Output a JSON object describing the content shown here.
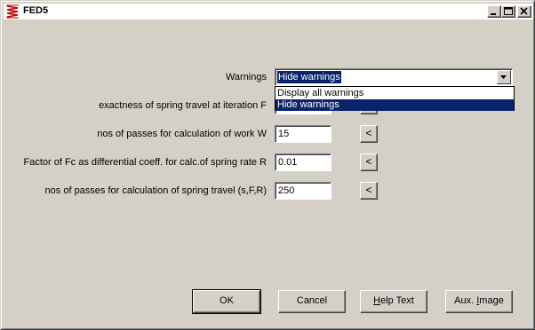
{
  "window": {
    "title": "FED5"
  },
  "form": {
    "warnings_label": "Warnings",
    "warnings_value": "Hide warnings",
    "warnings_options": [
      "Display all warnings",
      "Hide warnings"
    ],
    "fields": [
      {
        "label": "exactness of spring travel at iteration F",
        "value": ""
      },
      {
        "label": "nos of passes for calculation of work W",
        "value": "15"
      },
      {
        "label": "Factor of Fc as differential coeff. for calc.of spring rate R",
        "value": "0.01"
      },
      {
        "label": "nos of passes for calculation of spring travel (s,F,R)",
        "value": "250"
      }
    ],
    "side_button_label": "<"
  },
  "buttons": {
    "ok": "OK",
    "cancel": "Cancel",
    "help_prefix": "H",
    "help_rest": "elp Text",
    "aux_prefix": "Aux. ",
    "aux_underline": "I",
    "aux_rest": "mage"
  }
}
